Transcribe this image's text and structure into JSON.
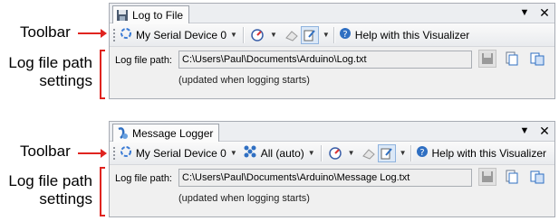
{
  "annotations": {
    "toolbar": "Toolbar",
    "settings_line1": "Log file path",
    "settings_line2": "settings"
  },
  "panels": [
    {
      "tab_title": "Log to File",
      "tab_icon": "floppy-disk-icon",
      "toolbar": {
        "device": "My Serial Device 0",
        "help": "Help with this Visualizer"
      },
      "path_label": "Log file path:",
      "path_value": "C:\\Users\\Paul\\Documents\\Arduino\\Log.txt",
      "note": "(updated when logging starts)"
    },
    {
      "tab_title": "Message Logger",
      "tab_icon": "message-logger-icon",
      "toolbar": {
        "device": "My Serial Device 0",
        "channel": "All (auto)",
        "help": "Help with this Visualizer"
      },
      "path_label": "Log file path:",
      "path_value": "C:\\Users\\Paul\\Documents\\Arduino\\Message Log.txt",
      "note": "(updated when logging starts)"
    }
  ],
  "colors": {
    "annotation": "#e0241f",
    "accent": "#2f6fc2"
  }
}
